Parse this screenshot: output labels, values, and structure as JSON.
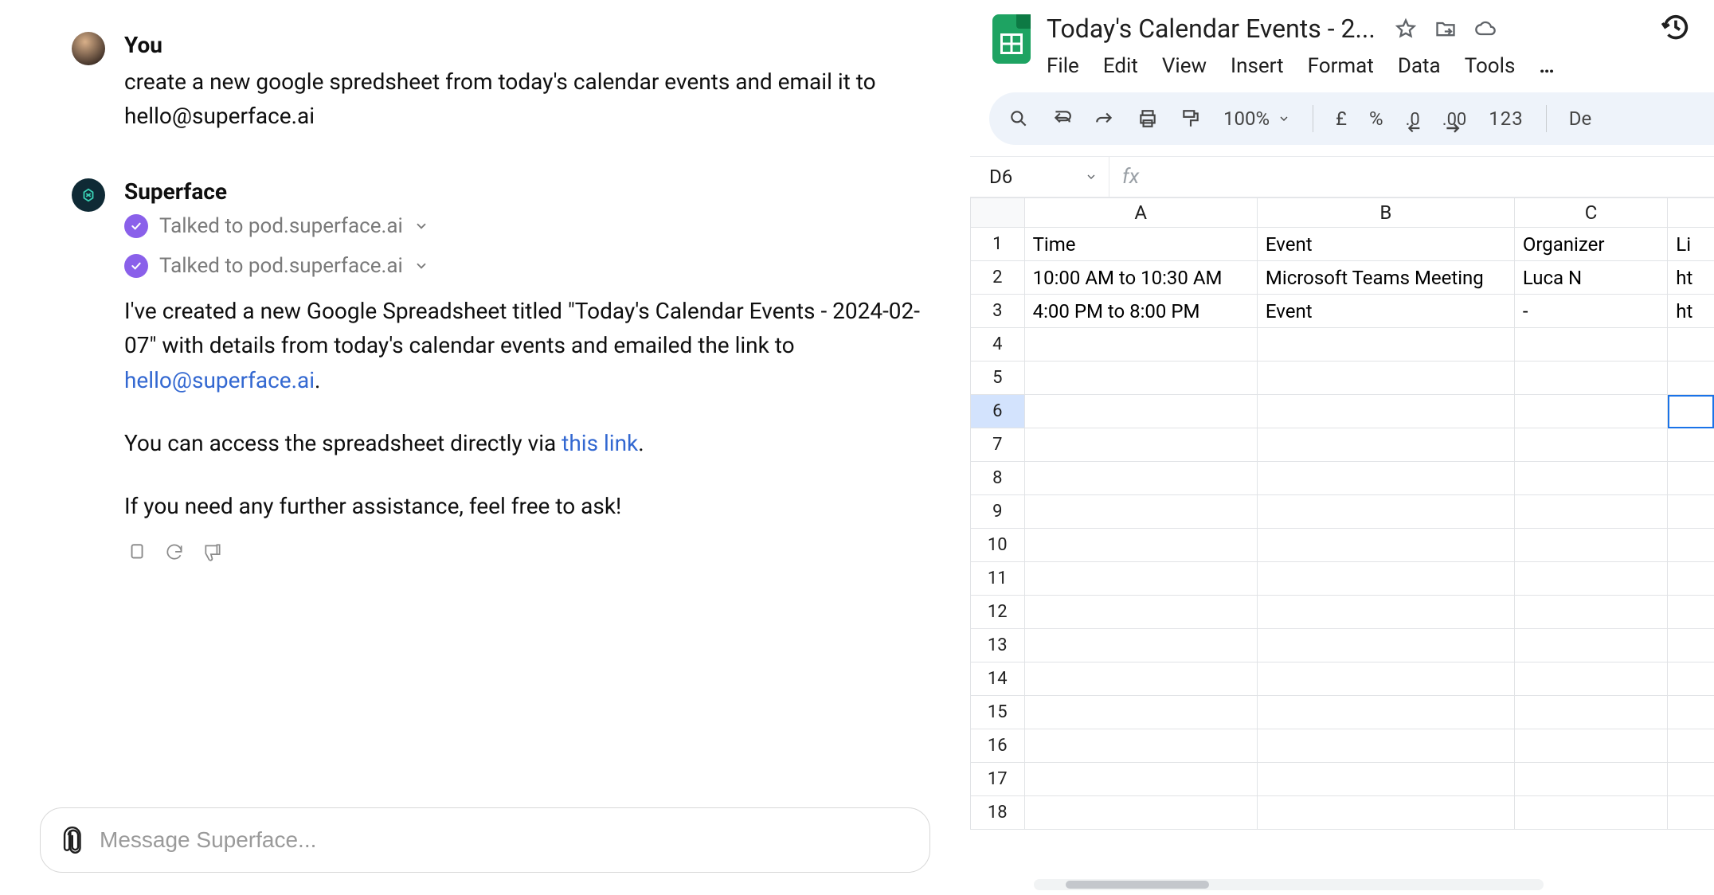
{
  "chat": {
    "user_name": "You",
    "user_message": "create a new google spredsheet from today's calendar events and email it to hello@superface.ai",
    "bot_name": "Superface",
    "tool_label": "Talked to pod.superface.ai",
    "reply_part1": "I've created a new Google Spreadsheet titled \"Today's Calendar Events - 2024-02-07\" with details from today's calendar events and emailed the link to ",
    "reply_email": "hello@superface.ai",
    "reply_part1_tail": ".",
    "reply_part2_pre": "You can access the spreadsheet directly via ",
    "reply_link_text": "this link",
    "reply_part2_tail": ".",
    "reply_part3": "If you need any further assistance, feel free to ask!",
    "composer_placeholder": "Message Superface..."
  },
  "sheets": {
    "doc_title": "Today's Calendar Events - 2...",
    "menus": [
      "File",
      "Edit",
      "View",
      "Insert",
      "Format",
      "Data",
      "Tools"
    ],
    "menu_more": "…",
    "zoom": "100%",
    "currency": "£",
    "percent": "%",
    "dec_dec": ".0",
    "dec_inc": ".00",
    "num_format": "123",
    "font_partial": "De",
    "namebox": "D6",
    "fx_label": "fx",
    "col_headers": [
      "A",
      "B",
      "C"
    ],
    "partial_col_header": "",
    "rows": [
      {
        "n": "1",
        "a": "Time",
        "b": "Event",
        "c": "Organizer",
        "d": "Li"
      },
      {
        "n": "2",
        "a": "10:00 AM to 10:30 AM",
        "b": "Microsoft Teams Meeting",
        "c": "Luca N",
        "d": "ht"
      },
      {
        "n": "3",
        "a": "4:00 PM to 8:00 PM",
        "b": "Event",
        "c": "-",
        "d": "ht"
      },
      {
        "n": "4",
        "a": "",
        "b": "",
        "c": "",
        "d": ""
      },
      {
        "n": "5",
        "a": "",
        "b": "",
        "c": "",
        "d": ""
      },
      {
        "n": "6",
        "a": "",
        "b": "",
        "c": "",
        "d": "",
        "sel": true
      },
      {
        "n": "7",
        "a": "",
        "b": "",
        "c": "",
        "d": ""
      },
      {
        "n": "8",
        "a": "",
        "b": "",
        "c": "",
        "d": ""
      },
      {
        "n": "9",
        "a": "",
        "b": "",
        "c": "",
        "d": ""
      },
      {
        "n": "10",
        "a": "",
        "b": "",
        "c": "",
        "d": ""
      },
      {
        "n": "11",
        "a": "",
        "b": "",
        "c": "",
        "d": ""
      },
      {
        "n": "12",
        "a": "",
        "b": "",
        "c": "",
        "d": ""
      },
      {
        "n": "13",
        "a": "",
        "b": "",
        "c": "",
        "d": ""
      },
      {
        "n": "14",
        "a": "",
        "b": "",
        "c": "",
        "d": ""
      },
      {
        "n": "15",
        "a": "",
        "b": "",
        "c": "",
        "d": ""
      },
      {
        "n": "16",
        "a": "",
        "b": "",
        "c": "",
        "d": ""
      },
      {
        "n": "17",
        "a": "",
        "b": "",
        "c": "",
        "d": ""
      },
      {
        "n": "18",
        "a": "",
        "b": "",
        "c": "",
        "d": ""
      }
    ]
  }
}
